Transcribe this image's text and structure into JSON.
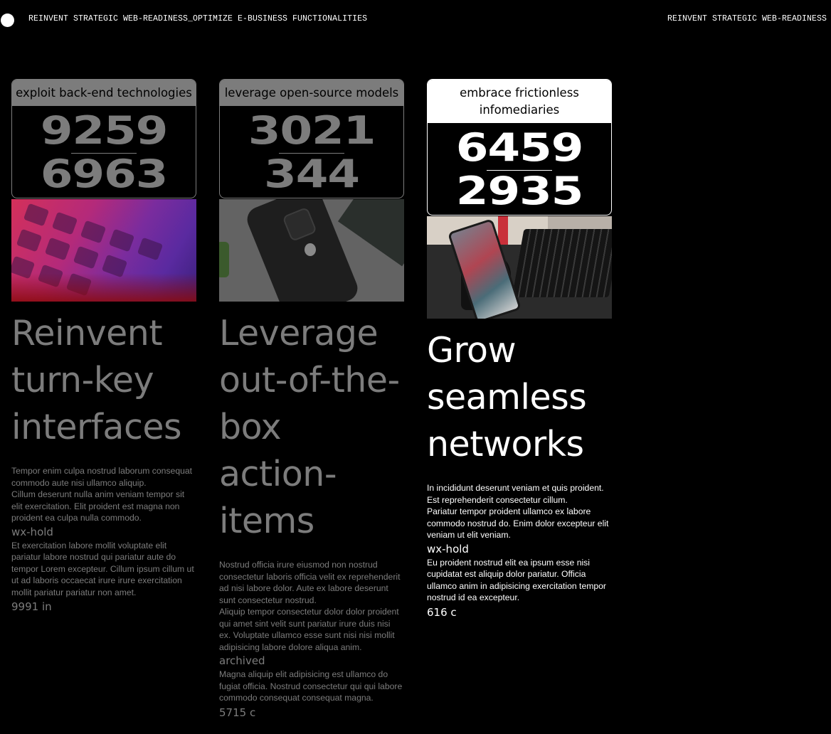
{
  "marquee": {
    "text": "REINVENT STRATEGIC WEB-READINESS_OPTIMIZE E-BUSINESS FUNCTIONALITIES",
    "text_repeat": "REINVENT STRATEGIC WEB-READINESS"
  },
  "cards": [
    {
      "box_title": "exploit back-end technologies",
      "num_top": "9259",
      "num_bottom": "6963",
      "heading": "Reinvent turn-key interfaces",
      "body1": "Tempor enim culpa nostrud laborum consequat commodo aute nisi ullamco aliquip.",
      "body2": "Cillum deserunt nulla anim veniam tempor sit elit exercitation. Elit proident est magna non proident ea culpa nulla commodo.",
      "tag": "wx-hold",
      "body3": "Et exercitation labore mollit voluptate elit pariatur labore nostrud qui pariatur aute do tempor Lorem excepteur. Cillum ipsum cillum ut ut ad laboris occaecat irure irure exercitation mollit pariatur pariatur non amet.",
      "foot": "9991 in"
    },
    {
      "box_title": "leverage open-source models",
      "num_top": "3021",
      "num_bottom": "344",
      "heading": "Leverage out-of-the-box action-items",
      "body1": "Nostrud officia irure eiusmod non nostrud consectetur laboris officia velit ex reprehenderit ad nisi labore dolor. Aute ex labore deserunt sunt consectetur nostrud.",
      "body2": "Aliquip tempor consectetur dolor dolor proident qui amet sint velit sunt pariatur irure duis nisi ex. Voluptate ullamco esse sunt nisi nisi mollit adipisicing labore dolore aliqua anim.",
      "tag": "archived",
      "body3": "Magna aliquip elit adipisicing est ullamco do fugiat officia. Nostrud consectetur qui qui labore commodo consequat consequat magna.",
      "foot": "5715 c"
    },
    {
      "box_title": "embrace frictionless infomediaries",
      "num_top": "6459",
      "num_bottom": "2935",
      "heading": "Grow seamless networks",
      "body1": "In incididunt deserunt veniam et quis proident. Est reprehenderit consectetur cillum.",
      "body2": "Pariatur tempor proident ullamco ex labore commodo nostrud do. Enim dolor excepteur elit veniam ut elit veniam.",
      "tag": "wx-hold",
      "body3": "Eu proident nostrud elit ea ipsum esse nisi cupidatat est aliquip dolor pariatur. Officia ullamco anim in adipisicing exercitation tempor nostrud id ea excepteur.",
      "foot": "616 c"
    }
  ]
}
